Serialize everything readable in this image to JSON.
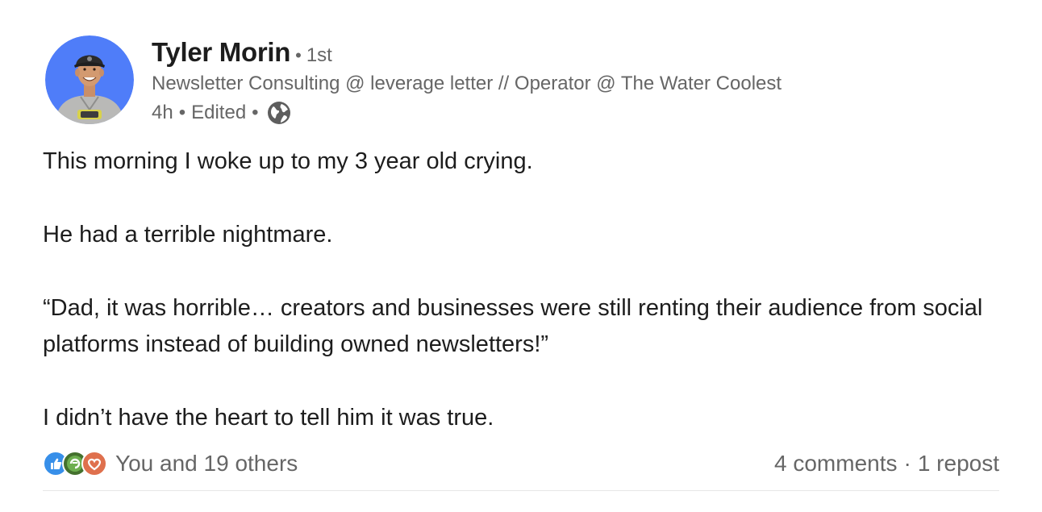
{
  "author": {
    "name": "Tyler Morin",
    "separator": "•",
    "degree": "1st",
    "headline": "Newsletter Consulting @ leverage letter // Operator @ The Water Coolest",
    "time": "4h",
    "edited": "Edited",
    "visibility_icon": "globe-icon",
    "avatar_bg": "#4f7df9"
  },
  "post": {
    "paragraphs": [
      "This morning I woke up to my 3 year old crying.",
      "He had a terrible nightmare.",
      "“Dad, it was horrible… creators and businesses were still renting their audience from social platforms instead of building owned newsletters!”",
      "I didn’t have the heart to tell him it was true."
    ]
  },
  "social": {
    "reaction_icons": [
      "like-icon",
      "celebrate-icon",
      "love-icon"
    ],
    "reaction_colors": [
      "#378fe9",
      "#44712e",
      "#df704d"
    ],
    "reactions_text": "You and 19 others",
    "comments": "4 comments",
    "separator": "·",
    "reposts": "1 repost"
  }
}
